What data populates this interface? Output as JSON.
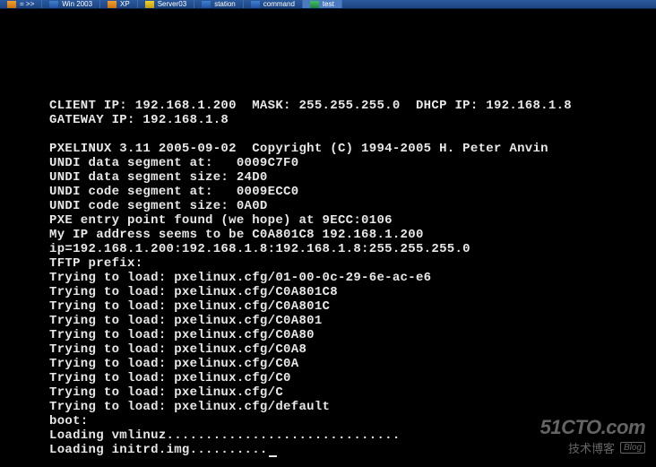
{
  "taskbar": {
    "items": [
      {
        "label": "= >>",
        "icon": "orange"
      },
      {
        "label": "Win 2003",
        "icon": "blue"
      },
      {
        "label": "XP",
        "icon": "orange"
      },
      {
        "label": "Server03",
        "icon": "yellow"
      },
      {
        "label": "station",
        "icon": "blue"
      },
      {
        "label": "command",
        "icon": "blue"
      },
      {
        "label": "test",
        "icon": "green",
        "active": true
      }
    ]
  },
  "terminal": {
    "lines": [
      "CLIENT IP: 192.168.1.200  MASK: 255.255.255.0  DHCP IP: 192.168.1.8",
      "GATEWAY IP: 192.168.1.8",
      "",
      "PXELINUX 3.11 2005-09-02  Copyright (C) 1994-2005 H. Peter Anvin",
      "UNDI data segment at:   0009C7F0",
      "UNDI data segment size: 24D0",
      "UNDI code segment at:   0009ECC0",
      "UNDI code segment size: 0A0D",
      "PXE entry point found (we hope) at 9ECC:0106",
      "My IP address seems to be C0A801C8 192.168.1.200",
      "ip=192.168.1.200:192.168.1.8:192.168.1.8:255.255.255.0",
      "TFTP prefix:",
      "Trying to load: pxelinux.cfg/01-00-0c-29-6e-ac-e6",
      "Trying to load: pxelinux.cfg/C0A801C8",
      "Trying to load: pxelinux.cfg/C0A801C",
      "Trying to load: pxelinux.cfg/C0A801",
      "Trying to load: pxelinux.cfg/C0A80",
      "Trying to load: pxelinux.cfg/C0A8",
      "Trying to load: pxelinux.cfg/C0A",
      "Trying to load: pxelinux.cfg/C0",
      "Trying to load: pxelinux.cfg/C",
      "Trying to load: pxelinux.cfg/default",
      "boot:",
      "Loading vmlinuz..............................",
      "Loading initrd.img.........."
    ]
  },
  "watermark": {
    "top": "51CTO.com",
    "bottom": "技术博客",
    "blog": "Blog"
  }
}
